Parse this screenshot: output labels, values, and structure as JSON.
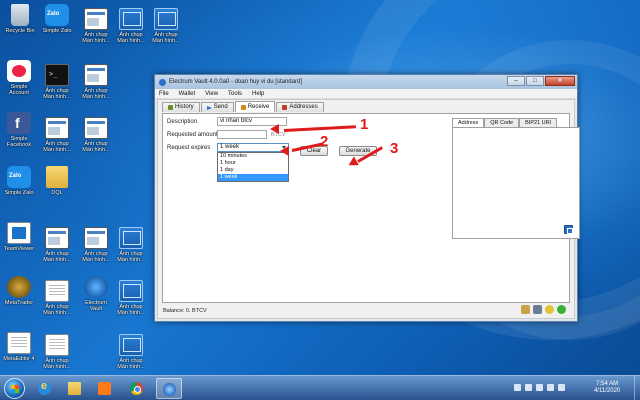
{
  "desktop": {
    "icons": [
      {
        "label": "Recycle Bin",
        "icon": "recycle-bin-icon"
      },
      {
        "label": "Simple Zalo",
        "icon": "zalo-icon"
      },
      {
        "label": "Ảnh chụp\nMàn hình...",
        "icon": "screenshot-file-icon"
      },
      {
        "label": "Ảnh chụp\nMàn hình...",
        "icon": "screenshot-file-icon"
      },
      {
        "label": "Ảnh chụp\nMàn hình...",
        "icon": "screenshot-file-icon"
      },
      {
        "label": "Simple\nAccount",
        "icon": "account-app-icon"
      },
      {
        "label": "Ảnh chụp\nMàn hình...",
        "icon": "screenshot-file-icon"
      },
      {
        "label": "Ảnh chụp\nMàn hình...",
        "icon": "screenshot-file-icon"
      },
      {
        "label": "Simple\nFacebook",
        "icon": "facebook-icon"
      },
      {
        "label": "Ảnh chụp\nMàn hình...",
        "icon": "screenshot-file-icon"
      },
      {
        "label": "Ảnh chụp\nMàn hình...",
        "icon": "screenshot-file-icon"
      },
      {
        "label": "Simple Zalo",
        "icon": "zalo-icon"
      },
      {
        "label": "DQL",
        "icon": "folder-icon"
      },
      {
        "label": "TeamViewer",
        "icon": "teamviewer-icon"
      },
      {
        "label": "Ảnh chụp\nMàn hình...",
        "icon": "screenshot-file-icon"
      },
      {
        "label": "Ảnh chụp\nMàn hình...",
        "icon": "screenshot-file-icon"
      },
      {
        "label": "Ảnh chụp\nMàn hình...",
        "icon": "screenshot-file-icon"
      },
      {
        "label": "MetaTrader",
        "icon": "metatrader-icon"
      },
      {
        "label": "Ảnh chụp\nMàn hình...",
        "icon": "screenshot-file-icon"
      },
      {
        "label": "Electrum\nVault",
        "icon": "electrum-icon"
      },
      {
        "label": "Ảnh chụp\nMàn hình...",
        "icon": "screenshot-file-icon"
      },
      {
        "label": "MetaEditor 4",
        "icon": "metaeditor-icon"
      },
      {
        "label": "Ảnh chụp\nMàn hình...",
        "icon": "screenshot-file-icon"
      },
      {
        "label": "Ảnh chụp\nMàn hình...",
        "icon": "screenshot-file-icon"
      }
    ]
  },
  "window": {
    "title": "Electrum Vault 4.0.0a0  -  doan huy vi du  [standard]",
    "minimize": "–",
    "maximize": "□",
    "close": "✕",
    "menu": [
      "File",
      "Wallet",
      "View",
      "Tools",
      "Help"
    ],
    "tabs": [
      "History",
      "Send",
      "Receive",
      "Addresses"
    ],
    "active_tab": "Receive",
    "form": {
      "description_label": "Description",
      "description_value": "vi nhan btcv",
      "amount_label": "Requested amount",
      "amount_value": "",
      "amount_unit": "BTCV",
      "expires_label": "Request expires",
      "expires_selected": "1 week",
      "expires_options": [
        "10 minutes",
        "1 hour",
        "1 day",
        "1 week"
      ],
      "expires_highlighted": "1 week",
      "clear_button": "Clear",
      "generate_button": "Generate"
    },
    "right_tabs": [
      "Address",
      "QR Code",
      "BIP21 URI"
    ],
    "right_active_tab": "Address",
    "status_balance": "Balance: 0. BTCV"
  },
  "annotations": [
    "1",
    "2",
    "3"
  ],
  "taskbar": {
    "apps": [
      "internet-explorer-icon",
      "folder-icon",
      "media-player-icon",
      "chrome-icon",
      "electrum-icon"
    ],
    "time": "7:54 AM",
    "date": "4/11/2020"
  },
  "colors": {
    "annotation": "#e01b1b",
    "selection": "#3399ff",
    "wallpaper": "#1167b8"
  }
}
